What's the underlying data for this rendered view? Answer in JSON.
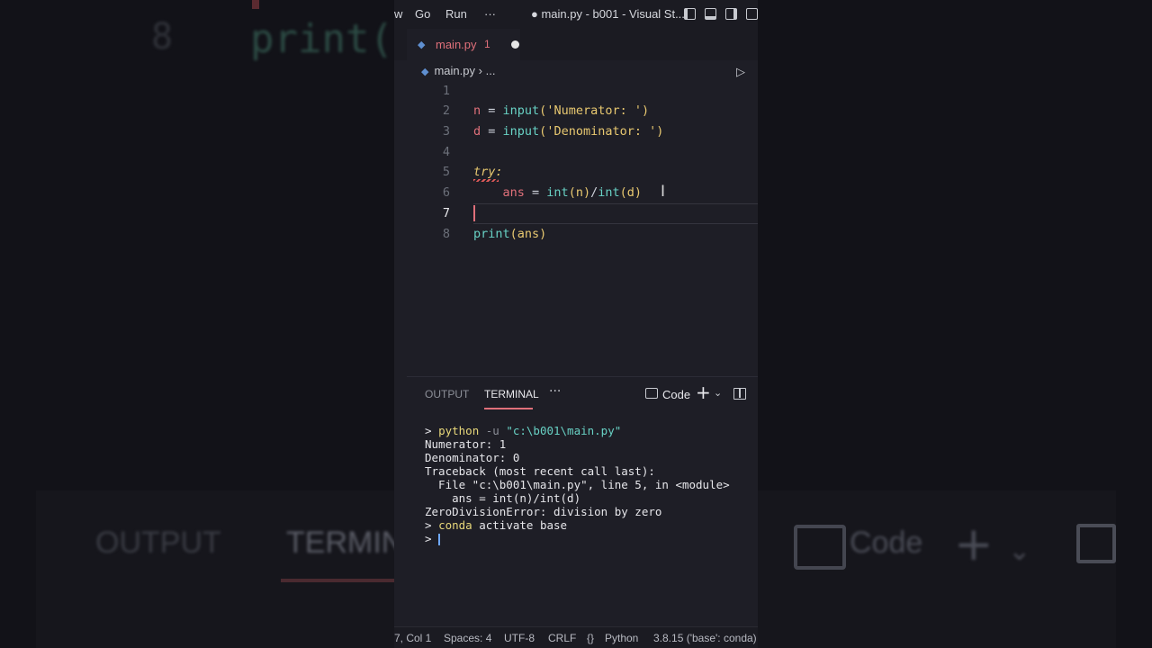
{
  "titlebar": {
    "menu_partial": "w",
    "menu_go": "Go",
    "menu_run": "Run",
    "menu_more": "···",
    "title": "● main.py - b001 - Visual St..."
  },
  "tab": {
    "filename": "main.py",
    "problems": "1"
  },
  "breadcrumb": {
    "file": "main.py",
    "sep": "›",
    "more": "..."
  },
  "editor": {
    "active_line": 7,
    "line_numbers": [
      "1",
      "2",
      "3",
      "4",
      "5",
      "6",
      "7",
      "8"
    ],
    "l2": {
      "var": "n",
      "op": " = ",
      "fn": "input",
      "open": "(",
      "str": "'Numerator: '",
      "close": ")"
    },
    "l3": {
      "var": "d",
      "op": " = ",
      "fn": "input",
      "open": "(",
      "str": "'Denominator: '",
      "close": ")"
    },
    "l5": {
      "kw": "try:"
    },
    "l6": {
      "indent": "    ",
      "var": "ans",
      "op": " = ",
      "fn1": "int",
      "a1": "(n)",
      "div": "/",
      "fn2": "int",
      "a2": "(d)"
    },
    "l8": {
      "fn": "print",
      "arg": "(ans)"
    }
  },
  "panel": {
    "tab_output": "OUTPUT",
    "tab_terminal": "TERMINAL",
    "menu_more": "···",
    "terminal_name": "Code",
    "plus": "+",
    "chevron": "⌄"
  },
  "terminal": {
    "prompt": ">",
    "cmd1": {
      "exe": "python",
      "flag": " -u ",
      "arg": "\"c:\\b001\\main.py\""
    },
    "lines": [
      "Numerator: 1",
      "Denominator: 0",
      "Traceback (most recent call last):",
      "  File \"c:\\b001\\main.py\", line 5, in <module>",
      "    ans = int(n)/int(d)",
      "ZeroDivisionError: division by zero"
    ],
    "cmd2": {
      "exe": "conda",
      "rest": " activate base"
    }
  },
  "statusbar": {
    "position": "7, Col 1",
    "spaces": "Spaces: 4",
    "encoding": "UTF-8",
    "eol": "CRLF",
    "lang_icon": "{}",
    "language": "Python",
    "interpreter": "3.8.15 ('base': conda)"
  },
  "background": {
    "line_num": "8",
    "code": "print(",
    "output": "OUTPUT",
    "terminal": "TERMIN",
    "code_label": "Code",
    "plus": "+",
    "chevron": "⌄"
  },
  "colors": {
    "accent": "#e0707a",
    "function": "#68d1c4",
    "string": "#e8c870",
    "editor_bg": "#1e1e26"
  }
}
